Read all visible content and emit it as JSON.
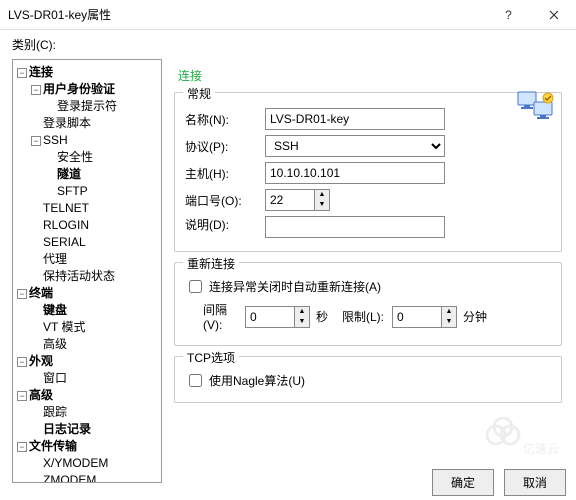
{
  "titlebar": {
    "title": "LVS-DR01-key属性"
  },
  "category_label": "类别(C):",
  "tree": {
    "connection": "连接",
    "auth": "用户身份验证",
    "loginprompt": "登录提示符",
    "loginscript": "登录脚本",
    "ssh": "SSH",
    "security": "安全性",
    "tunnel": "隧道",
    "sftp": "SFTP",
    "telnet": "TELNET",
    "rlogin": "RLOGIN",
    "serial": "SERIAL",
    "proxy": "代理",
    "keepalive": "保持活动状态",
    "terminal": "终端",
    "keyboard": "键盘",
    "vtmode": "VT 模式",
    "advanced": "高级",
    "appearance": "外观",
    "window": "窗口",
    "advanced2": "高级",
    "trace": "跟踪",
    "logging": "日志记录",
    "filetransfer": "文件传输",
    "xymodem": "X/YMODEM",
    "zmodem": "ZMODEM"
  },
  "panel": {
    "title": "连接",
    "general": {
      "legend": "常规",
      "name_label": "名称(N):",
      "name_value": "LVS-DR01-key",
      "protocol_label": "协议(P):",
      "protocol_value": "SSH",
      "host_label": "主机(H):",
      "host_value": "10.10.10.101",
      "port_label": "端口号(O):",
      "port_value": "22",
      "desc_label": "说明(D):",
      "desc_value": ""
    },
    "reconnect": {
      "legend": "重新连接",
      "auto_label": "连接异常关闭时自动重新连接(A)",
      "interval_label": "间隔(V):",
      "interval_value": "0",
      "interval_unit": "秒",
      "limit_label": "限制(L):",
      "limit_value": "0",
      "limit_unit": "分钟"
    },
    "tcp": {
      "legend": "TCP选项",
      "nagle_label": "使用Nagle算法(U)"
    }
  },
  "footer": {
    "ok": "确定",
    "cancel": "取消"
  },
  "watermark": "亿速云"
}
